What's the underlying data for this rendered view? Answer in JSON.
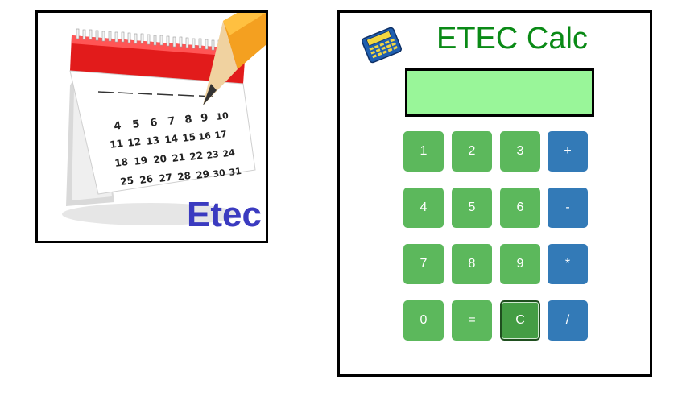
{
  "logo": {
    "text": "Etec",
    "calendar_numbers": [
      "4",
      "5",
      "6",
      "7",
      "8",
      "9",
      "10",
      "11",
      "12",
      "13",
      "14",
      "15",
      "16",
      "17",
      "18",
      "19",
      "20",
      "21",
      "22",
      "23",
      "24",
      "25",
      "26",
      "27",
      "28",
      "29",
      "30",
      "31"
    ]
  },
  "calculator": {
    "title": "ETEC Calc",
    "display_value": "",
    "keys": [
      {
        "label": "1"
      },
      {
        "label": "2"
      },
      {
        "label": "3"
      },
      {
        "label": "+"
      },
      {
        "label": "4"
      },
      {
        "label": "5"
      },
      {
        "label": "6"
      },
      {
        "label": "-"
      },
      {
        "label": "7"
      },
      {
        "label": "8"
      },
      {
        "label": "9"
      },
      {
        "label": "*"
      },
      {
        "label": "0"
      },
      {
        "label": "="
      },
      {
        "label": "C"
      },
      {
        "label": "/"
      }
    ]
  },
  "colors": {
    "title_green": "#0a8a16",
    "display_bg": "#99f699",
    "number_key": "#5cb85c",
    "operator_key": "#337ab7",
    "clear_key": "#449d44"
  }
}
